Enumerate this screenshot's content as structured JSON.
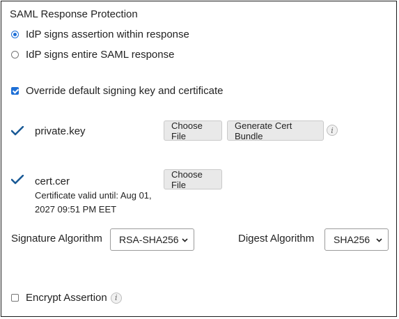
{
  "saml": {
    "title": "SAML Response Protection",
    "options": [
      {
        "label": "IdP signs assertion within response",
        "selected": true
      },
      {
        "label": "IdP signs entire SAML response",
        "selected": false
      }
    ]
  },
  "override": {
    "label": "Override default signing key and certificate",
    "checked": true
  },
  "private_key": {
    "filename": "private.key",
    "choose_label": "Choose File",
    "generate_label": "Generate Cert Bundle",
    "info_icon": "info-icon"
  },
  "cert": {
    "filename": "cert.cer",
    "validity_line1": "Certificate valid until: Aug 01,",
    "validity_line2": "2027 09:51 PM EET",
    "choose_label": "Choose File"
  },
  "signature": {
    "label": "Signature Algorithm",
    "value": "RSA-SHA256"
  },
  "digest": {
    "label": "Digest Algorithm",
    "value": "SHA256"
  },
  "encrypt": {
    "label": "Encrypt Assertion",
    "checked": false
  },
  "colors": {
    "accent": "#1e6fd6",
    "checkmark": "#1a5a96",
    "button_bg": "#e9e9e9"
  }
}
